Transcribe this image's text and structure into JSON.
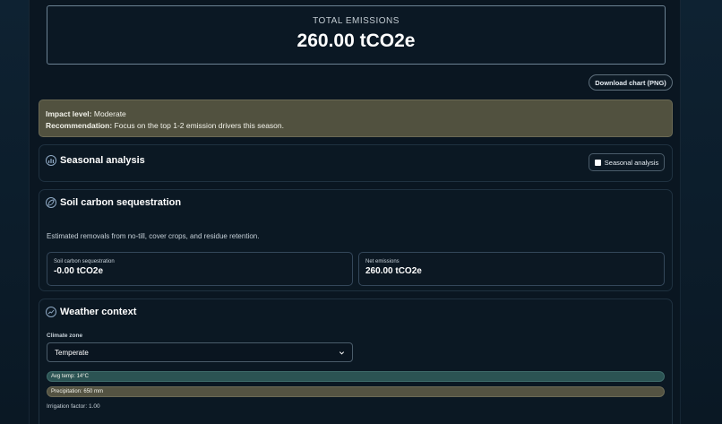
{
  "total": {
    "label": "TOTAL EMISSIONS",
    "value": "260.00 tCO2e"
  },
  "download_button": "Download chart (PNG)",
  "impact": {
    "level_label": "Impact level:",
    "level_value": "Moderate",
    "recommendation_label": "Recommendation:",
    "recommendation_value": "Focus on the top 1-2 emission drivers this season."
  },
  "seasonal": {
    "title": "Seasonal analysis",
    "toggle_label": "Seasonal analysis",
    "icon": "bar-chart-icon"
  },
  "soil": {
    "title": "Soil carbon sequestration",
    "icon": "leaf-icon",
    "description": "Estimated removals from no-till, cover crops, and residue retention.",
    "metrics": [
      {
        "label": "Soil carbon sequestration",
        "value": "-0.00 tCO2e"
      },
      {
        "label": "Net emissions",
        "value": "260.00 tCO2e"
      }
    ]
  },
  "weather": {
    "title": "Weather context",
    "icon": "weather-icon",
    "climate_label": "Climate zone",
    "climate_value": "Temperate",
    "avg_temp": "Avg temp: 14°C",
    "precipitation": "Precipitation: 650 mm",
    "irrigation": "Irrigation factor: 1.00"
  },
  "colors": {
    "background": "#0a1621",
    "impact_bg": "#51513f",
    "temp_bar": "#2b5353",
    "precip_bar": "#545342"
  }
}
